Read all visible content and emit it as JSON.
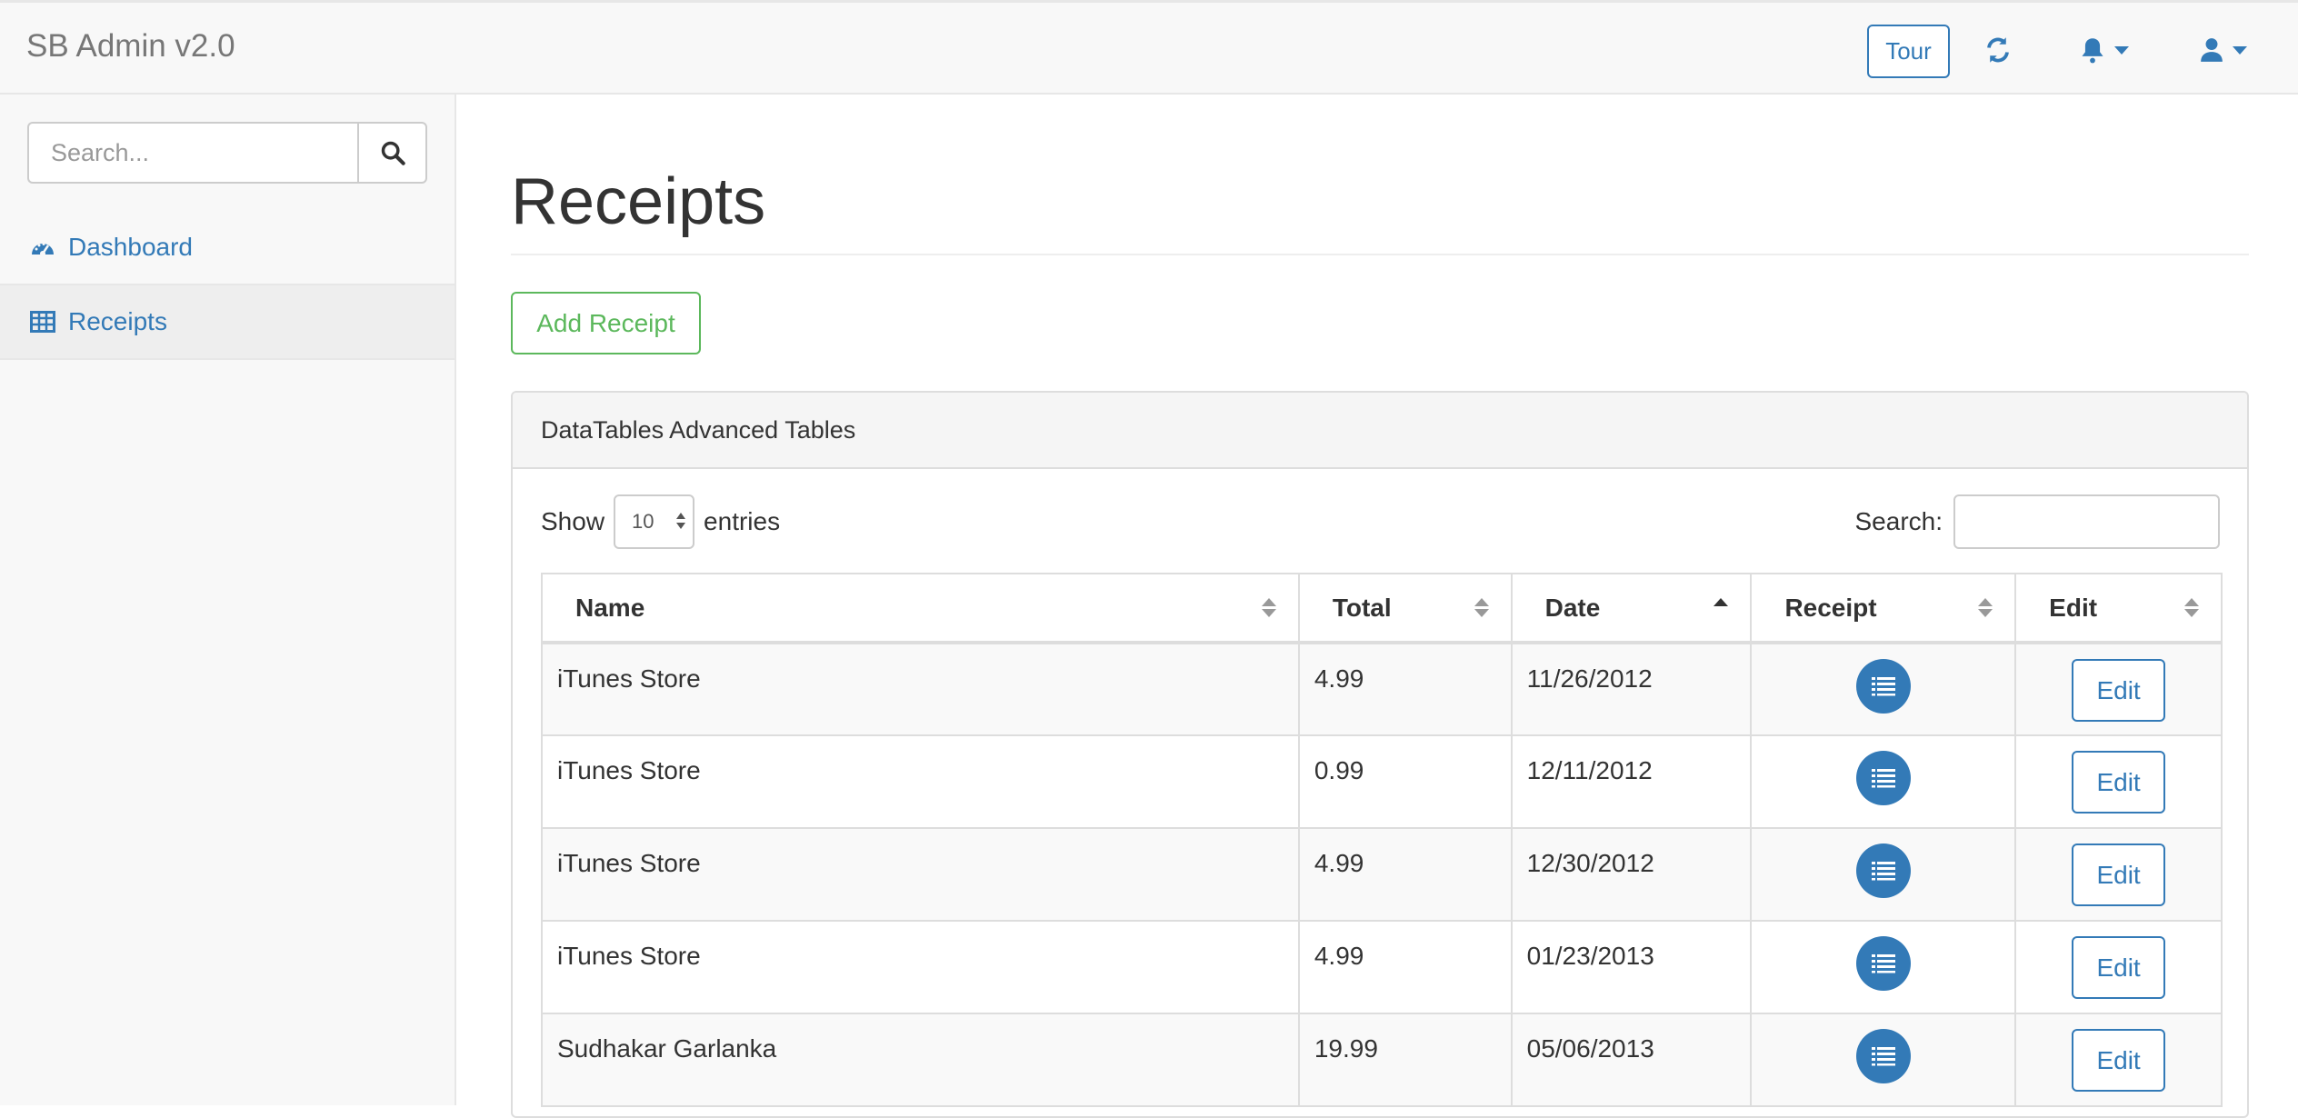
{
  "navbar": {
    "brand": "SB Admin v2.0",
    "tour_label": "Tour",
    "icons": [
      "refresh-icon",
      "bell-icon",
      "user-icon"
    ],
    "accent_color": "#337ab7"
  },
  "sidebar": {
    "search_placeholder": "Search...",
    "items": [
      {
        "label": "Dashboard",
        "icon": "dashboard-icon",
        "active": false
      },
      {
        "label": "Receipts",
        "icon": "table-icon",
        "active": true
      }
    ]
  },
  "main": {
    "title": "Receipts",
    "add_button": "Add Receipt",
    "add_button_color": "#5cb85c",
    "panel_heading": "DataTables Advanced Tables",
    "show_label": "Show",
    "entries_value": "10",
    "entries_label": "entries",
    "search_label": "Search:",
    "columns": [
      "Name",
      "Total",
      "Date",
      "Receipt",
      "Edit"
    ],
    "sorted_column": "Date",
    "rows": [
      {
        "name": "iTunes Store",
        "total": "4.99",
        "date": "11/26/2012",
        "edit": "Edit"
      },
      {
        "name": "iTunes Store",
        "total": "0.99",
        "date": "12/11/2012",
        "edit": "Edit"
      },
      {
        "name": "iTunes Store",
        "total": "4.99",
        "date": "12/30/2012",
        "edit": "Edit"
      },
      {
        "name": "iTunes Store",
        "total": "4.99",
        "date": "01/23/2013",
        "edit": "Edit"
      },
      {
        "name": "Sudhakar Garlanka",
        "total": "19.99",
        "date": "05/06/2013",
        "edit": "Edit"
      }
    ]
  }
}
